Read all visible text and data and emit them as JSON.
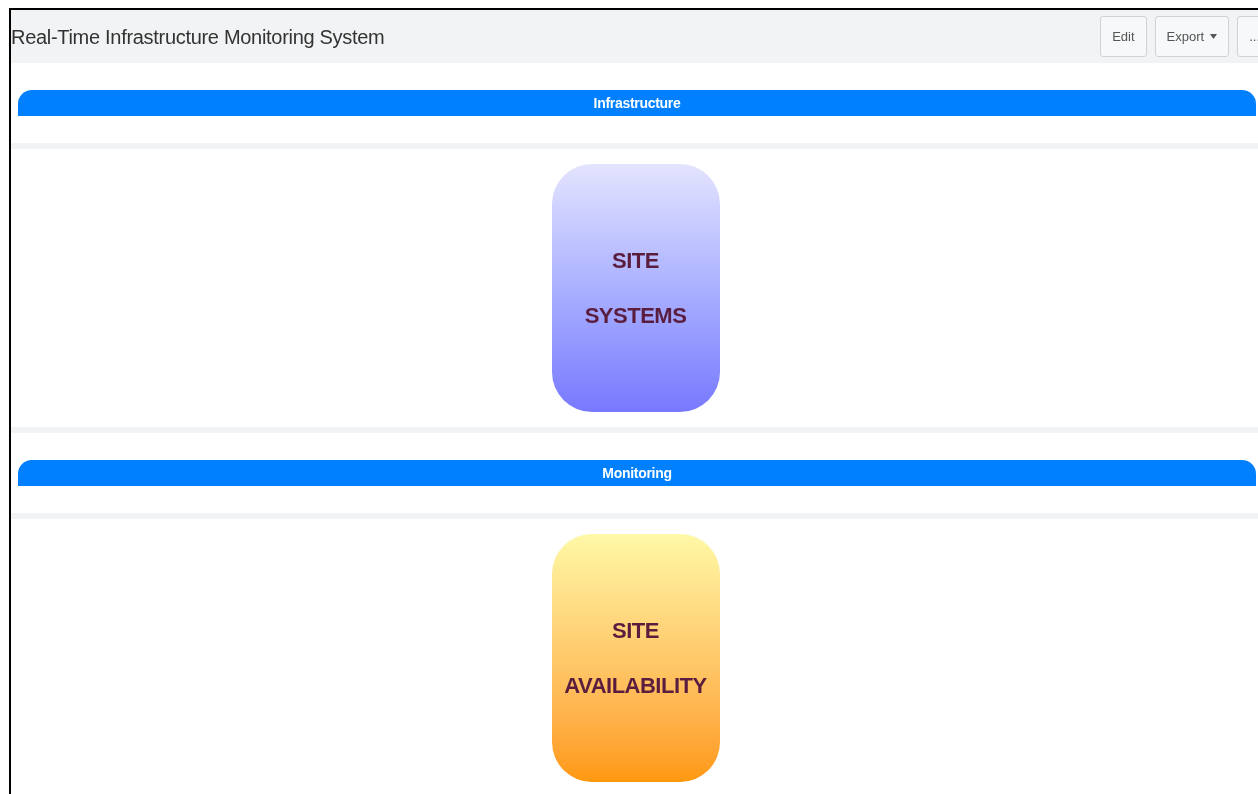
{
  "header": {
    "title": "Real-Time Infrastructure Monitoring System",
    "buttons": [
      {
        "label": "Edit",
        "dropdown": false
      },
      {
        "label": "Export",
        "dropdown": true
      },
      {
        "label": "...",
        "dropdown": false
      }
    ]
  },
  "sections": [
    {
      "heading": "Infrastructure",
      "tile": {
        "kind": "systems",
        "lines": [
          "SITE",
          "SYSTEMS"
        ]
      }
    },
    {
      "heading": "Monitoring",
      "tile": {
        "kind": "availability",
        "lines": [
          "SITE",
          "AVAILABILITY"
        ]
      }
    }
  ]
}
